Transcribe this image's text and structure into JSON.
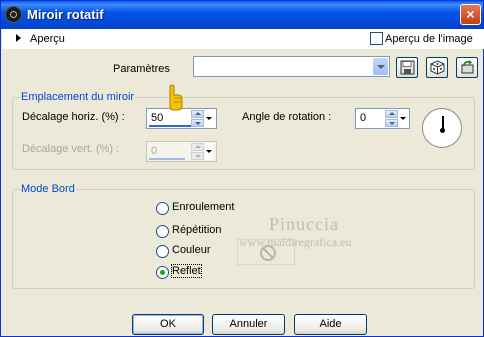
{
  "window": {
    "title": "Miroir rotatif",
    "close": "×"
  },
  "preview": {
    "label": "Aperçu",
    "image_preview_label": "Aperçu de l'image",
    "image_preview_checked": false
  },
  "params": {
    "label": "Paramètres",
    "selected": ""
  },
  "mirror_group": {
    "legend": "Emplacement du miroir",
    "h_offset_label": "Décalage horiz. (%) :",
    "h_offset_value": "50",
    "v_offset_label": "Décalage vert. (%) :",
    "v_offset_value": "0",
    "rotation_label": "Angle de rotation :",
    "rotation_value": "0"
  },
  "edge_group": {
    "legend": "Mode Bord",
    "options": [
      "Enroulement",
      "Répétition",
      "Couleur",
      "Reflet"
    ],
    "selected": "Reflet"
  },
  "watermark": {
    "line1": "Pinuccia",
    "line2": "www.maldiregrafica.eu"
  },
  "buttons": {
    "ok": "OK",
    "cancel": "Annuler",
    "help": "Aide"
  }
}
